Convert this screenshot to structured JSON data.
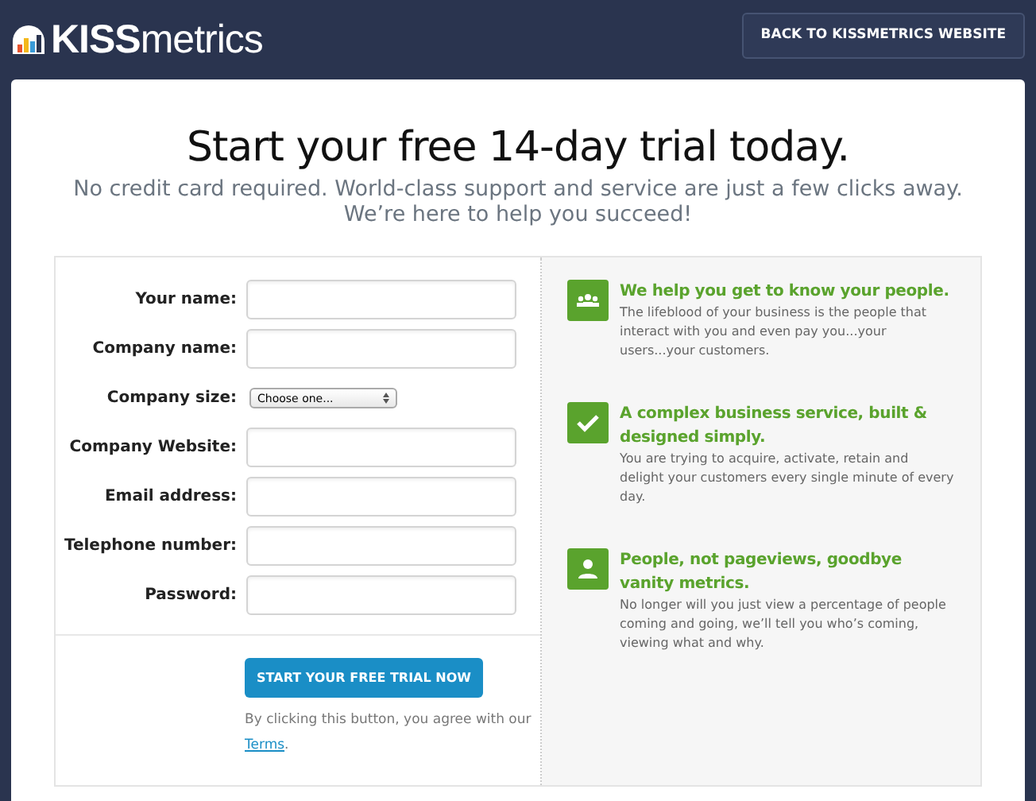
{
  "header": {
    "logo": {
      "strong": "KISS",
      "light": "metrics"
    },
    "back_button": "BACK TO KISSMETRICS WEBSITE"
  },
  "hero": {
    "title": "Start your free 14-day trial today.",
    "subtitle": "No credit card required. World-class support and service are just a few clicks away. We’re here to help you succeed!"
  },
  "form": {
    "fields": [
      {
        "label": "Your name:",
        "kind": "text"
      },
      {
        "label": "Company name:",
        "kind": "text"
      },
      {
        "label": "Company size:",
        "kind": "select",
        "value": "Choose one..."
      },
      {
        "label": "Company Website:",
        "kind": "text"
      },
      {
        "label": "Email address:",
        "kind": "text"
      },
      {
        "label": "Telephone number:",
        "kind": "text"
      },
      {
        "label": "Password:",
        "kind": "password"
      }
    ],
    "submit": "START YOUR FREE TRIAL NOW",
    "agreement": "By clicking this button, you agree with our",
    "terms_link": "Terms",
    "terms_end": "."
  },
  "features": [
    {
      "title": "We help you get to know your people.",
      "text": "The lifeblood of your business is the people that interact with you and even pay you...your users...your customers."
    },
    {
      "title": "A complex business service, built & designed simply.",
      "text": "You are trying to acquire, activate, retain and delight your customers every single minute of every day."
    },
    {
      "title": "People, not pageviews, goodbye vanity metrics.",
      "text": "No longer will you just view a percentage of people coming and going, we’ll tell you who’s coming, viewing what and why."
    }
  ]
}
